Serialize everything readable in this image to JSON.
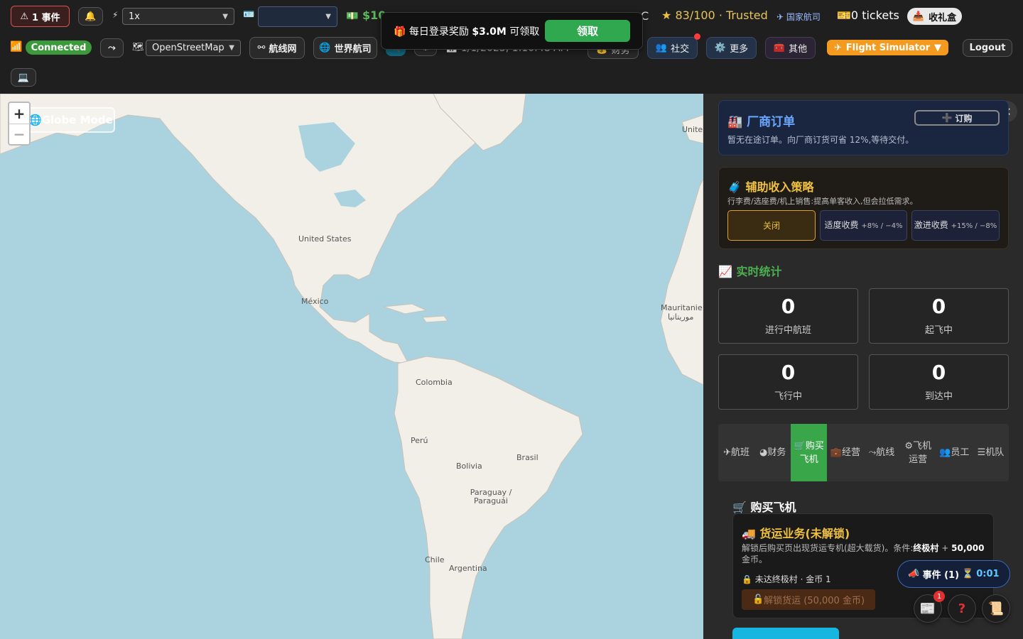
{
  "topbar": {
    "event_btn": {
      "icon": "warning-icon",
      "label": "1 事件"
    },
    "bell_icon": "bell-icon",
    "speed_icon": "lightning-icon",
    "speed_value": "1x",
    "id_icon": "id-card-icon",
    "airline_value": "",
    "money": "$10",
    "temp_tail": "C",
    "reputation": "83/100 · Trusted",
    "national_airline": "国家航司",
    "tickets": "0 tickets",
    "inbox_label": "收礼盒",
    "connection": "Connected",
    "map_style": "OpenStreetMap",
    "route_network_label": "航线网",
    "world_airlines_label": "世界航司",
    "datetime": "1/1/2025, 1:10:48 AM",
    "finance_label": "财务",
    "social_label": "社交",
    "more_label": "更多",
    "other_label": "其他",
    "flight_sim_label": "Flight Simulator",
    "logout_label": "Logout"
  },
  "toast": {
    "prefix": "每日登录奖励",
    "amount": "$3.0M",
    "suffix": "可领取",
    "claim_label": "领取"
  },
  "map": {
    "globe_mode_label": "Globe Mode",
    "zoom_in": "+",
    "zoom_out": "−",
    "labels": {
      "united_states": "United States",
      "mexico": "México",
      "colombia": "Colombia",
      "peru": "Perú",
      "brasil": "Brasil",
      "bolivia": "Bolivia",
      "paraguay": "Paraguay / Paraguái",
      "chile": "Chile",
      "argentina": "Argentina",
      "mauritanie": "Mauritanie",
      "mauritanie_ar": "موريتانيا",
      "united": "Unite"
    }
  },
  "panel": {
    "manufacturer": {
      "title": "厂商订单",
      "order_label": "订购",
      "desc": "暂无在途订单。向厂商订货可省 12%,等待交付。"
    },
    "ancillary": {
      "title": "辅助收入策略",
      "desc": "行李费/选座费/机上销售:提高单客收入,但会拉低需求。",
      "options": [
        {
          "label": "关闭",
          "sub": ""
        },
        {
          "label": "适度收费",
          "sub": "+8% / −4%"
        },
        {
          "label": "激进收费",
          "sub": "+15% / −8%"
        }
      ]
    },
    "stats": {
      "title": "实时统计",
      "items": [
        {
          "value": "0",
          "label": "进行中航班"
        },
        {
          "value": "0",
          "label": "起飞中"
        },
        {
          "value": "0",
          "label": "飞行中"
        },
        {
          "value": "0",
          "label": "到达中"
        }
      ]
    },
    "tabs": [
      {
        "icon": "plane-icon",
        "label": "航班"
      },
      {
        "icon": "pie-chart-icon",
        "label": "财务"
      },
      {
        "icon": "cart-icon",
        "label": "购买飞机"
      },
      {
        "icon": "briefcase-icon",
        "label": "经营"
      },
      {
        "icon": "route-icon",
        "label": "航线"
      },
      {
        "icon": "gears-icon",
        "label": "飞机运营"
      },
      {
        "icon": "users-icon",
        "label": "员工"
      },
      {
        "icon": "list-icon",
        "label": "机队"
      }
    ],
    "buy": {
      "title": "购买飞机",
      "cargo_title": "货运业务(未解锁)",
      "cargo_desc_pre": "解锁后购买页出现货运专机(超大载货)。条件:",
      "cargo_cond1": "终极村",
      "cargo_plus": " + ",
      "cargo_cond2": "50,000",
      "cargo_desc_post": " 金币。",
      "cargo_status": "未达终极村 · 金币 1",
      "unlock_label": "解锁货运 (50,000 金币)"
    }
  },
  "floating": {
    "event_label": "事件 (1)",
    "timer": "0:01",
    "news_badge": "1"
  }
}
